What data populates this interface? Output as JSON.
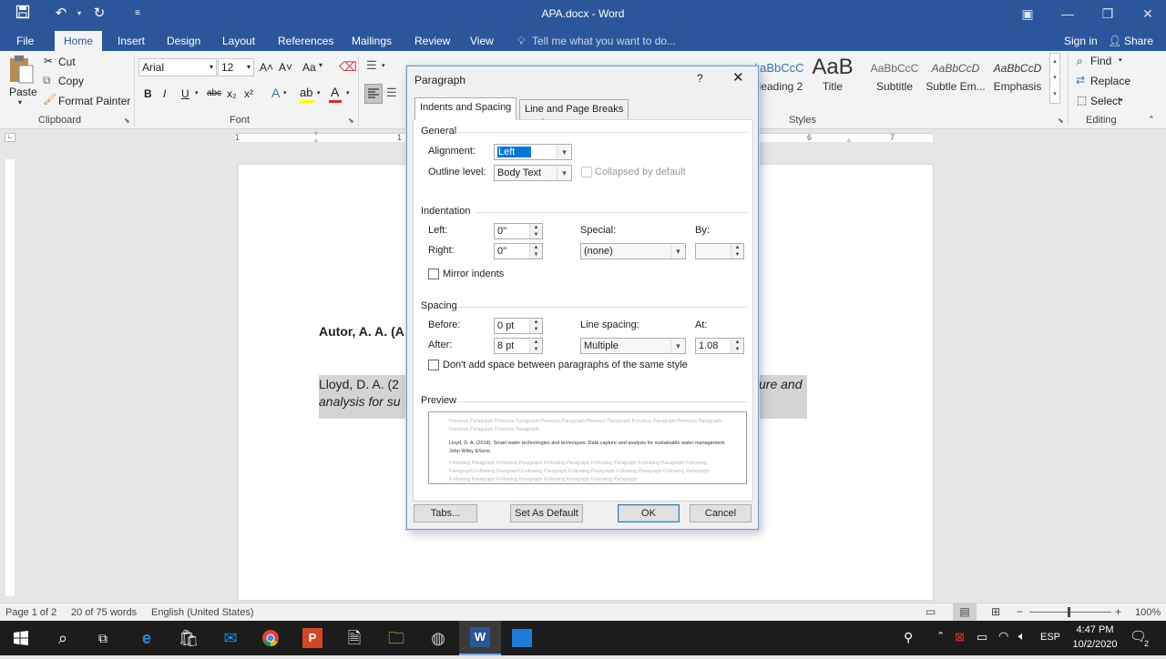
{
  "titlebar": {
    "title": "APA.docx - Word",
    "restore_icon": "ribbon-display-icon"
  },
  "tabs": [
    "File",
    "Home",
    "Insert",
    "Design",
    "Layout",
    "References",
    "Mailings",
    "Review",
    "View"
  ],
  "tell_me": "Tell me what you want to do...",
  "signin": "Sign in",
  "share": "Share",
  "clipboard": {
    "paste": "Paste",
    "cut": "Cut",
    "copy": "Copy",
    "format_painter": "Format Painter",
    "label": "Clipboard"
  },
  "font": {
    "family": "Arial",
    "size": "12",
    "label": "Font",
    "bold": "B",
    "italic": "I",
    "underline": "U",
    "strike": "abc",
    "sub": "x₂",
    "sup": "x²",
    "grow": "A˄",
    "shrink": "A˅",
    "case": "Aa"
  },
  "styles": {
    "label": "Styles",
    "items": [
      {
        "sample": "AaBbCcC",
        "name": "Heading 2"
      },
      {
        "sample": "AaB",
        "name": "Title"
      },
      {
        "sample": "AaBbCcC",
        "name": "Subtitle"
      },
      {
        "sample": "AaBbCcD",
        "name": "Subtle Em..."
      },
      {
        "sample": "AaBbCcD",
        "name": "Emphasis"
      }
    ]
  },
  "editing": {
    "label": "Editing",
    "find": "Find",
    "replace": "Replace",
    "select": "Select"
  },
  "ruler_numbers": [
    "1",
    "6",
    "7"
  ],
  "document": {
    "line1": "Autor, A. A. (A",
    "line2a": "Lloyd, D. A. (2",
    "line2b": "analysis for su",
    "line2c": "ure and"
  },
  "dialog": {
    "title": "Paragraph",
    "help": "?",
    "tabs": [
      "Indents and Spacing",
      "Line and Page Breaks"
    ],
    "general": "General",
    "alignment_label": "Alignment:",
    "alignment_value": "Left",
    "outline_label": "Outline level:",
    "outline_value": "Body Text",
    "collapsed": "Collapsed by default",
    "indentation": "Indentation",
    "left_label": "Left:",
    "left_value": "0\"",
    "right_label": "Right:",
    "right_value": "0\"",
    "special_label": "Special:",
    "special_value": "(none)",
    "by_label": "By:",
    "by_value": "",
    "mirror": "Mirror indents",
    "spacing": "Spacing",
    "before_label": "Before:",
    "before_value": "0 pt",
    "after_label": "After:",
    "after_value": "8 pt",
    "line_spacing_label": "Line spacing:",
    "line_spacing_value": "Multiple",
    "at_label": "At:",
    "at_value": "1.08",
    "dont_add": "Don't add space between paragraphs of the same style",
    "preview": "Preview",
    "preview_prev": "Previous Paragraph Previous Paragraph Previous Paragraph Previous Paragraph Previous Paragraph Previous Paragraph Previous Paragraph Previous Paragraph",
    "preview_main": "Lloyd, D. A. (2018). Smart water technologies and techniques: Data capture and analysis for sustainable water management. John Wiley &Sons.",
    "preview_next": "Following Paragraph Following Paragraph Following Paragraph Following Paragraph Following Paragraph Following Paragraph Following Paragraph Following Paragraph Following Paragraph Following Paragraph Following Paragraph Following Paragraph Following Paragraph Following Paragraph Following Paragraph",
    "tabs_btn": "Tabs...",
    "default_btn": "Set As Default",
    "ok": "OK",
    "cancel": "Cancel"
  },
  "status": {
    "page": "Page 1 of 2",
    "words": "20 of 75 words",
    "lang": "English (United States)",
    "zoom": "100%"
  },
  "taskbar": {
    "lang": "ESP",
    "time": "4:47 PM",
    "date": "10/2/2020",
    "notif": "2"
  }
}
